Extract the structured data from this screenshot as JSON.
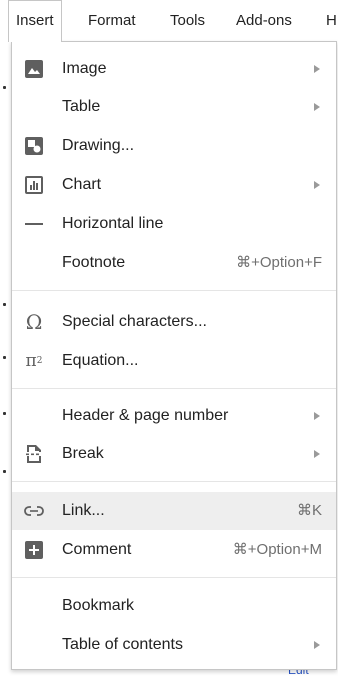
{
  "menubar": {
    "items": [
      "Insert",
      "Format",
      "Tools",
      "Add-ons",
      "H"
    ]
  },
  "menu": {
    "items": [
      {
        "label": "Image",
        "icon": "image-icon",
        "submenu": true
      },
      {
        "label": "Table",
        "icon": "",
        "submenu": true
      },
      {
        "label": "Drawing...",
        "icon": "drawing-icon",
        "submenu": false
      },
      {
        "label": "Chart",
        "icon": "chart-icon",
        "submenu": true
      },
      {
        "label": "Horizontal line",
        "icon": "horizontal-line-icon",
        "submenu": false
      },
      {
        "label": "Footnote",
        "icon": "",
        "shortcut": "⌘+Option+F"
      },
      {
        "label": "Special characters...",
        "icon": "omega-icon",
        "submenu": false
      },
      {
        "label": "Equation...",
        "icon": "pi-squared-icon",
        "submenu": false
      },
      {
        "label": "Header & page number",
        "icon": "",
        "submenu": true
      },
      {
        "label": "Break",
        "icon": "page-break-icon",
        "submenu": true
      },
      {
        "label": "Link...",
        "icon": "link-icon",
        "shortcut": "⌘K",
        "highlighted": true
      },
      {
        "label": "Comment",
        "icon": "comment-add-icon",
        "shortcut": "⌘+Option+M"
      },
      {
        "label": "Bookmark",
        "icon": "",
        "submenu": false
      },
      {
        "label": "Table of contents",
        "icon": "",
        "submenu": true
      }
    ]
  },
  "background": {
    "partial_text": "Edit"
  }
}
